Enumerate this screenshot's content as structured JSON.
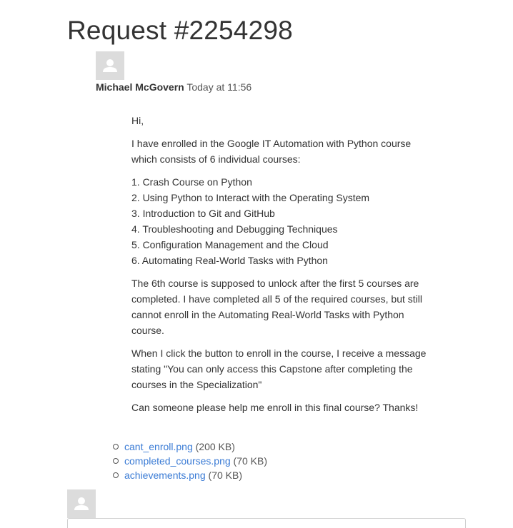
{
  "request": {
    "title": "Request #2254298"
  },
  "comment": {
    "author": "Michael McGovern",
    "time": "Today at 11:56",
    "avatar_icon": "default-user-avatar-icon",
    "greeting": "Hi,",
    "intro": "I have enrolled in the Google IT Automation with Python course which consists of 6 individual courses:",
    "courses": [
      "1. Crash Course on Python",
      "2. Using Python to Interact with the Operating System",
      "3. Introduction to Git and GitHub",
      "4. Troubleshooting and Debugging Techniques",
      "5. Configuration Management and the Cloud",
      "6. Automating Real-World Tasks with Python"
    ],
    "paragraph_problem": "The 6th course is supposed to unlock after the first 5 courses are completed. I have completed all 5 of the required courses, but still cannot enroll in the Automating Real-World Tasks with Python course.",
    "paragraph_message": "When I click the button to enroll in the course, I receive a message stating \"You can only access this Capstone after completing the courses in the Specialization\"",
    "paragraph_ask": "Can someone please help me enroll in this final course? Thanks!"
  },
  "attachments": [
    {
      "name": "cant_enroll.png",
      "size": "(200 KB)"
    },
    {
      "name": "completed_courses.png",
      "size": "(70 KB)"
    },
    {
      "name": "achievements.png",
      "size": "(70 KB)"
    }
  ],
  "reply": {
    "avatar_icon": "default-user-avatar-icon"
  },
  "colors": {
    "link": "#3a7bd5",
    "text": "#333333",
    "avatar_bg": "#dcdcdc"
  }
}
